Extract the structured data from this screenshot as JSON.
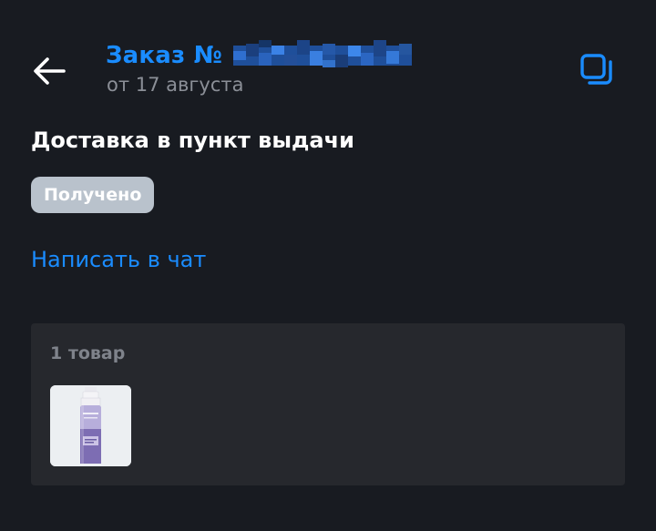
{
  "header": {
    "title": "Заказ №",
    "date": "от 17 августа",
    "accent_color": "#1a8cff",
    "back_icon": "arrow-left-icon",
    "copy_icon": "copy-icon"
  },
  "delivery": {
    "title": "Доставка в пункт выдачи"
  },
  "status": {
    "label": "Получено",
    "color": "#b9c2cc"
  },
  "chat": {
    "label": "Написать в чат"
  },
  "items": {
    "count_label": "1 товар",
    "products": [
      {
        "image": "foam-cleanser-bottle"
      }
    ]
  }
}
